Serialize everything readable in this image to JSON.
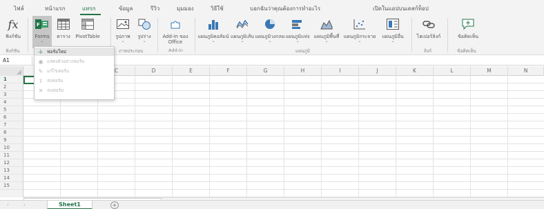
{
  "menu": {
    "tabs": [
      {
        "label": "ไฟล์"
      },
      {
        "label": "หน้าแรก"
      },
      {
        "label": "แทรก"
      },
      {
        "label": "ข้อมูล"
      },
      {
        "label": "รีวิว"
      },
      {
        "label": "มุมมอง"
      },
      {
        "label": "วิธีใช้"
      },
      {
        "label": "บอกฉันว่าคุณต้องการทำอะไร"
      },
      {
        "label": "เปิดในแอปบนเดสก์ท็อป"
      }
    ]
  },
  "ribbon": {
    "function": {
      "label": "ฟังก์ชัน"
    },
    "forms": {
      "label": "Forms"
    },
    "table": {
      "label": "ตาราง"
    },
    "pivottable": {
      "label": "PivotTable"
    },
    "picture": {
      "label": "รูปภาพ"
    },
    "shapes": {
      "label": "รูปร่าง"
    },
    "addin": {
      "label": "Add-in ของ Office"
    },
    "chart_column": {
      "label": "แผนภูมิคอลัมน์"
    },
    "chart_line": {
      "label": "แผนภูมิเส้น"
    },
    "chart_pie": {
      "label": "แผนภูมิวงกลม"
    },
    "chart_bar": {
      "label": "แผนภูมิแท่ง"
    },
    "chart_area": {
      "label": "แผนภูมิพื้นที่"
    },
    "chart_scatter": {
      "label": "แผนภูมิกระจาย"
    },
    "chart_other": {
      "label": "แผนภูมิอื่น"
    },
    "hyperlink": {
      "label": "ไฮเปอร์ลิงก์"
    },
    "comment": {
      "label": "ข้อคิดเห็น"
    },
    "groups": {
      "function": "ฟังก์ชัน",
      "illustrations": "ภาพประกอบ",
      "addins": "Add-in",
      "charts": "แผนภูมิ",
      "links": "ลิงก์",
      "comments": "ข้อคิดเห็น"
    }
  },
  "formula_bar": {
    "name_box": "A1"
  },
  "columns": [
    "C",
    "D",
    "E",
    "F",
    "G",
    "H",
    "I",
    "J",
    "K",
    "L",
    "M",
    "N"
  ],
  "rows": [
    "1",
    "2",
    "3",
    "4",
    "5",
    "6",
    "7",
    "8",
    "9",
    "10",
    "11",
    "12",
    "13",
    "14",
    "15"
  ],
  "dropdown": {
    "items": [
      {
        "label": "ฟอร์มใหม่",
        "icon": "plus-icon",
        "enabled": true
      },
      {
        "label": "แสดงตัวอย่างฟอร์ม",
        "icon": "eye-icon",
        "enabled": false
      },
      {
        "label": "แก้ไขฟอร์ม",
        "icon": "pencil-icon",
        "enabled": false
      },
      {
        "label": "ส่งฟอร์ม",
        "icon": "share-icon",
        "enabled": false
      },
      {
        "label": "ลบฟอร์ม",
        "icon": "delete-x-icon",
        "enabled": false
      }
    ]
  },
  "sheets": [
    {
      "name": "Sheet1"
    }
  ],
  "add_sheet": "+",
  "colors": {
    "accent": "#217346",
    "ribbon_bg": "#f3f3f3",
    "grid_line": "#e3e3e3"
  }
}
